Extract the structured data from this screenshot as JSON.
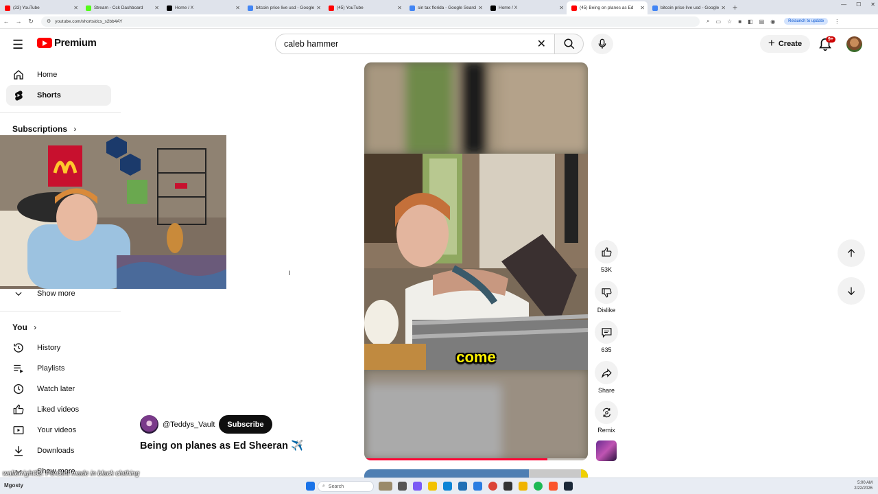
{
  "browser": {
    "tabs": [
      {
        "title": "(33) YouTube",
        "color": "#ff0000",
        "active": false
      },
      {
        "title": "Stream - Cck Dashboard",
        "color": "#53fc18",
        "active": false
      },
      {
        "title": "Home / X",
        "color": "#000000",
        "active": false
      },
      {
        "title": "bitcoin price live usd - Google",
        "color": "#4285f4",
        "active": false
      },
      {
        "title": "(45) YouTube",
        "color": "#ff0000",
        "active": false
      },
      {
        "title": "sin tax florida - Google Search",
        "color": "#4285f4",
        "active": false
      },
      {
        "title": "Home / X",
        "color": "#000000",
        "active": false
      },
      {
        "title": "(45) Being on planes as Ed",
        "color": "#ff0000",
        "active": true
      },
      {
        "title": "bitcoin price live usd - Google",
        "color": "#4285f4",
        "active": false
      }
    ],
    "new_tab": "+",
    "url": "youtube.com/shorts/dcs_s2bb4AY",
    "relaunch": "Relaunch to update"
  },
  "header": {
    "logo_text": "Premium",
    "search_query": "caleb hammer",
    "create_label": "Create",
    "notification_count": "9+"
  },
  "sidebar": {
    "home": "Home",
    "shorts": "Shorts",
    "subscriptions": "Subscriptions",
    "show_more": "Show more",
    "you": "You",
    "history": "History",
    "playlists": "Playlists",
    "watch_later": "Watch later",
    "liked_videos": "Liked videos",
    "your_videos": "Your videos",
    "downloads": "Downloads",
    "show_more_2": "Show more"
  },
  "short": {
    "caption": "come",
    "progress": 0.82,
    "channel": "@Teddys_Vault",
    "subscribe": "Subscribe",
    "title": "Being on planes as Ed Sheeran ✈️"
  },
  "actions": {
    "likes": "53K",
    "dislike": "Dislike",
    "comments": "635",
    "share": "Share",
    "remix": "Remix"
  },
  "overlay": {
    "text": "walterright32: Percent made in black clothing"
  },
  "taskbar": {
    "left_label": "Mgosty",
    "search": "Search",
    "time": "5:00 AM",
    "date": "2/22/2026"
  },
  "colors": {
    "brand_red": "#ff0000",
    "progress_red": "#ff0033",
    "caption_yellow": "#fff200"
  }
}
